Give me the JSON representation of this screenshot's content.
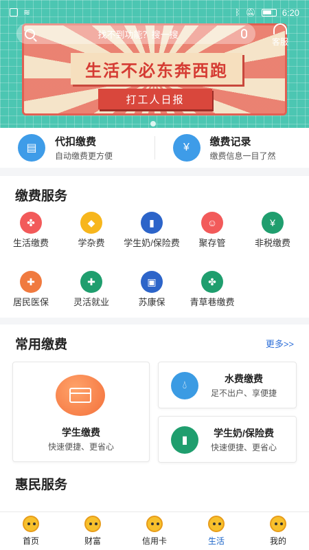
{
  "status": {
    "time": "6:20"
  },
  "banner": {
    "search_placeholder": "找不到功能？搜一搜",
    "service_label": "客服",
    "headline": "生活不必东奔西跑",
    "tag": "打工人日报"
  },
  "quick": [
    {
      "title": "代扣缴费",
      "subtitle": "自动缴费更方便",
      "icon": "document-icon"
    },
    {
      "title": "缴费记录",
      "subtitle": "缴费信息一目了然",
      "icon": "yen-icon"
    }
  ],
  "pay_services": {
    "title": "缴费服务",
    "items": [
      {
        "label": "生活缴费",
        "color": "#f25a5a",
        "icon": "clover-icon"
      },
      {
        "label": "学杂费",
        "color": "#f7b61c",
        "icon": "graduation-cap-icon"
      },
      {
        "label": "学生奶/保险费",
        "color": "#2c64c9",
        "icon": "milk-icon"
      },
      {
        "label": "聚存管",
        "color": "#f25a5a",
        "icon": "face-icon"
      },
      {
        "label": "非税缴费",
        "color": "#1f9e6e",
        "icon": "money-bag-icon"
      },
      {
        "label": "居民医保",
        "color": "#f07a3f",
        "icon": "nurse-cap-icon"
      },
      {
        "label": "灵活就业",
        "color": "#1f9e6e",
        "icon": "medical-kit-icon"
      },
      {
        "label": "苏康保",
        "color": "#2c64c9",
        "icon": "briefcase-icon"
      },
      {
        "label": "青草巷缴费",
        "color": "#1f9e6e",
        "icon": "clover-icon"
      }
    ]
  },
  "common_pay": {
    "title": "常用缴费",
    "more": "更多>>",
    "cards": [
      {
        "title": "学生缴费",
        "subtitle": "快速便捷、更省心"
      },
      {
        "title": "水费缴费",
        "subtitle": "足不出户、享便捷",
        "color": "#3b9be3"
      },
      {
        "title": "学生奶/保险费",
        "subtitle": "快速便捷、更省心",
        "color": "#1f9e6e"
      }
    ]
  },
  "huimin": {
    "title": "惠民服务"
  },
  "tabs": [
    {
      "label": "首页"
    },
    {
      "label": "财富"
    },
    {
      "label": "信用卡"
    },
    {
      "label": "生活",
      "active": true
    },
    {
      "label": "我的"
    }
  ]
}
